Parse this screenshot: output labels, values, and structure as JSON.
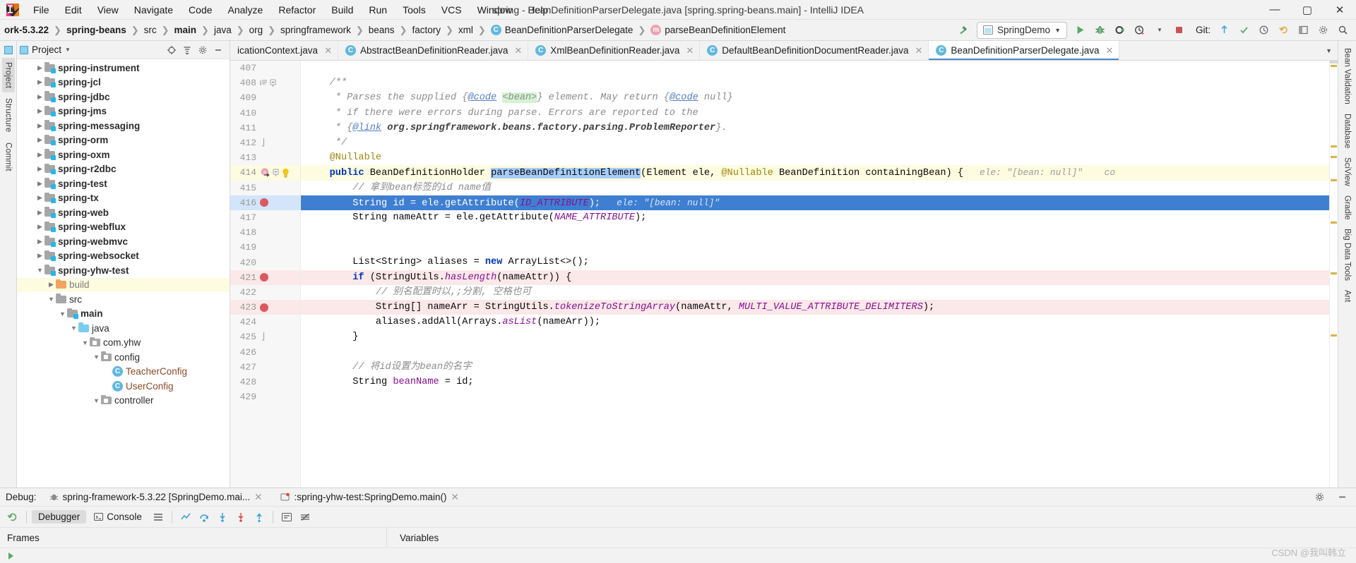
{
  "window": {
    "title": "spring - BeanDefinitionParserDelegate.java [spring.spring-beans.main] - IntelliJ IDEA",
    "minimize": "—",
    "maximize": "▢",
    "close": "✕"
  },
  "menu": {
    "items": [
      "File",
      "Edit",
      "View",
      "Navigate",
      "Code",
      "Analyze",
      "Refactor",
      "Build",
      "Run",
      "Tools",
      "VCS",
      "Window",
      "Help"
    ]
  },
  "breadcrumbs": {
    "items": [
      {
        "label": "ork-5.3.22",
        "bold": true,
        "icon": ""
      },
      {
        "label": "spring-beans",
        "bold": true,
        "icon": ""
      },
      {
        "label": "src",
        "bold": false,
        "icon": ""
      },
      {
        "label": "main",
        "bold": true,
        "icon": ""
      },
      {
        "label": "java",
        "bold": false,
        "icon": ""
      },
      {
        "label": "org",
        "bold": false,
        "icon": ""
      },
      {
        "label": "springframework",
        "bold": false,
        "icon": ""
      },
      {
        "label": "beans",
        "bold": false,
        "icon": ""
      },
      {
        "label": "factory",
        "bold": false,
        "icon": ""
      },
      {
        "label": "xml",
        "bold": false,
        "icon": ""
      },
      {
        "label": "BeanDefinitionParserDelegate",
        "bold": false,
        "icon": "class"
      },
      {
        "label": "parseBeanDefinitionElement",
        "bold": false,
        "icon": "method"
      }
    ],
    "separator": "❯"
  },
  "toolbar": {
    "build_icon": "hammer-icon",
    "run_config": "SpringDemo",
    "run_config_icon": "app-window-icon",
    "dropdown_arrow": "▼",
    "run_label": "▶",
    "debug_label": "debug-icon",
    "run_coverage_label": "coverage-icon",
    "profiler_label": "profiler-icon",
    "stop_label": "■",
    "git_label": "Git:",
    "git_update": "update-icon",
    "git_commit": "commit-icon",
    "git_history": "history-icon",
    "git_rollback": "rollback-icon",
    "search_label": "🔍",
    "settings_label": "gear-icon",
    "layout_label": "layout-icon"
  },
  "left_rail": {
    "items": [
      {
        "label": "Project",
        "selected": true
      },
      {
        "label": "Structure",
        "selected": false
      },
      {
        "label": "Commit",
        "selected": false
      }
    ]
  },
  "right_rail": {
    "items": [
      "Bean Validation",
      "Database",
      "SciView",
      "Gradle",
      "Big Data Tools",
      "Ant"
    ]
  },
  "project_panel": {
    "title": "Project",
    "dropdown": "▼",
    "actions": [
      "target-icon",
      "collapse-all-icon",
      "settings-icon",
      "hide-icon"
    ],
    "tree": [
      {
        "indent": 1,
        "arrow": "▶",
        "icon": "module-folder",
        "label": "spring-instrument",
        "bold": true,
        "highlight": false
      },
      {
        "indent": 1,
        "arrow": "▶",
        "icon": "module-folder",
        "label": "spring-jcl",
        "bold": true,
        "highlight": false
      },
      {
        "indent": 1,
        "arrow": "▶",
        "icon": "module-folder",
        "label": "spring-jdbc",
        "bold": true,
        "highlight": false
      },
      {
        "indent": 1,
        "arrow": "▶",
        "icon": "module-folder",
        "label": "spring-jms",
        "bold": true,
        "highlight": false
      },
      {
        "indent": 1,
        "arrow": "▶",
        "icon": "module-folder",
        "label": "spring-messaging",
        "bold": true,
        "highlight": false
      },
      {
        "indent": 1,
        "arrow": "▶",
        "icon": "module-folder",
        "label": "spring-orm",
        "bold": true,
        "highlight": false
      },
      {
        "indent": 1,
        "arrow": "▶",
        "icon": "module-folder",
        "label": "spring-oxm",
        "bold": true,
        "highlight": false
      },
      {
        "indent": 1,
        "arrow": "▶",
        "icon": "module-folder",
        "label": "spring-r2dbc",
        "bold": true,
        "highlight": false
      },
      {
        "indent": 1,
        "arrow": "▶",
        "icon": "module-folder",
        "label": "spring-test",
        "bold": true,
        "highlight": false
      },
      {
        "indent": 1,
        "arrow": "▶",
        "icon": "module-folder",
        "label": "spring-tx",
        "bold": true,
        "highlight": false
      },
      {
        "indent": 1,
        "arrow": "▶",
        "icon": "module-folder",
        "label": "spring-web",
        "bold": true,
        "highlight": false
      },
      {
        "indent": 1,
        "arrow": "▶",
        "icon": "module-folder",
        "label": "spring-webflux",
        "bold": true,
        "highlight": false
      },
      {
        "indent": 1,
        "arrow": "▶",
        "icon": "module-folder",
        "label": "spring-webmvc",
        "bold": true,
        "highlight": false
      },
      {
        "indent": 1,
        "arrow": "▶",
        "icon": "module-folder",
        "label": "spring-websocket",
        "bold": true,
        "highlight": false
      },
      {
        "indent": 1,
        "arrow": "▼",
        "icon": "module-folder",
        "label": "spring-yhw-test",
        "bold": true,
        "highlight": false
      },
      {
        "indent": 2,
        "arrow": "▶",
        "icon": "excluded-folder",
        "label": "build",
        "bold": false,
        "highlight": true,
        "grey": true
      },
      {
        "indent": 2,
        "arrow": "▼",
        "icon": "plain-folder",
        "label": "src",
        "bold": false,
        "highlight": false
      },
      {
        "indent": 3,
        "arrow": "▼",
        "icon": "module-folder",
        "label": "main",
        "bold": true,
        "highlight": false
      },
      {
        "indent": 4,
        "arrow": "▼",
        "icon": "source-folder",
        "label": "java",
        "bold": false,
        "highlight": false
      },
      {
        "indent": 5,
        "arrow": "▼",
        "icon": "package",
        "label": "com.yhw",
        "bold": false,
        "highlight": false
      },
      {
        "indent": 6,
        "arrow": "▼",
        "icon": "package",
        "label": "config",
        "bold": false,
        "highlight": false
      },
      {
        "indent": 7,
        "arrow": "",
        "icon": "class",
        "label": "TeacherConfig",
        "bold": false,
        "highlight": false,
        "cls": true
      },
      {
        "indent": 7,
        "arrow": "",
        "icon": "class",
        "label": "UserConfig",
        "bold": false,
        "highlight": false,
        "cls": true
      },
      {
        "indent": 6,
        "arrow": "▼",
        "icon": "package",
        "label": "controller",
        "bold": false,
        "highlight": false
      }
    ]
  },
  "editor_tabs": {
    "items": [
      {
        "label": "icationContext.java",
        "icon": "",
        "active": false,
        "close": "✕"
      },
      {
        "label": "AbstractBeanDefinitionReader.java",
        "icon": "class",
        "active": false,
        "close": "✕"
      },
      {
        "label": "XmlBeanDefinitionReader.java",
        "icon": "class",
        "active": false,
        "close": "✕"
      },
      {
        "label": "DefaultBeanDefinitionDocumentReader.java",
        "icon": "class",
        "active": false,
        "close": "✕"
      },
      {
        "label": "BeanDefinitionParserDelegate.java",
        "icon": "class",
        "active": true,
        "close": "✕"
      }
    ],
    "overflow": "▼",
    "settings_icon": "gear-icon",
    "hide_icon": "—"
  },
  "code": {
    "lines": [
      {
        "num": "407",
        "state": "normal",
        "segments": [],
        "icons": []
      },
      {
        "num": "408",
        "state": "hl_none",
        "icons": [
          "doc-marker",
          "fold-open"
        ],
        "segments": [
          {
            "t": "    ",
            "c": ""
          },
          {
            "t": "/**",
            "c": "jd"
          }
        ]
      },
      {
        "num": "409",
        "state": "normal",
        "icons": [],
        "segments": [
          {
            "t": "     * Parses the supplied {",
            "c": "jd"
          },
          {
            "t": "@code",
            "c": "jdlink"
          },
          {
            "t": " ",
            "c": "jd"
          },
          {
            "t": "<bean>",
            "c": "jd hlgreen"
          },
          {
            "t": "} element. May return {",
            "c": "jd"
          },
          {
            "t": "@code",
            "c": "jdlink"
          },
          {
            "t": " null}",
            "c": "jd"
          }
        ]
      },
      {
        "num": "410",
        "state": "normal",
        "icons": [],
        "segments": [
          {
            "t": "     * if there were errors during parse. Errors are reported to the",
            "c": "jd"
          }
        ]
      },
      {
        "num": "411",
        "state": "normal",
        "icons": [],
        "segments": [
          {
            "t": "     * {",
            "c": "jd"
          },
          {
            "t": "@link",
            "c": "jdlink"
          },
          {
            "t": " ",
            "c": "jd"
          },
          {
            "t": "org.springframework.beans.factory.parsing.ProblemReporter",
            "c": "jdtag"
          },
          {
            "t": "}.",
            "c": "jd"
          }
        ]
      },
      {
        "num": "412",
        "state": "normal",
        "icons": [
          "fold-close"
        ],
        "segments": [
          {
            "t": "     */",
            "c": "jd"
          }
        ]
      },
      {
        "num": "413",
        "state": "normal",
        "icons": [],
        "segments": [
          {
            "t": "    ",
            "c": ""
          },
          {
            "t": "@Nullable",
            "c": "ann"
          }
        ]
      },
      {
        "num": "414",
        "state": "hl",
        "icons": [
          "method-run",
          "fold-open",
          "bulb"
        ],
        "segments": [
          {
            "t": "    ",
            "c": ""
          },
          {
            "t": "public",
            "c": "kw"
          },
          {
            "t": " BeanDefinitionHolder ",
            "c": ""
          },
          {
            "t": "parseBeanDefinitionElement",
            "c": "sel"
          },
          {
            "t": "(Element ele, ",
            "c": ""
          },
          {
            "t": "@Nullable",
            "c": "ann"
          },
          {
            "t": " BeanDefinition containingBean) {",
            "c": ""
          },
          {
            "t": "   ele: \"[bean: null]\"    co",
            "c": "inlineval"
          }
        ]
      },
      {
        "num": "415",
        "state": "normal",
        "icons": [],
        "segments": [
          {
            "t": "        ",
            "c": ""
          },
          {
            "t": "// 拿到bean标签的id name值",
            "c": "cmt"
          }
        ]
      },
      {
        "num": "416",
        "state": "cur",
        "icons": [
          "bp"
        ],
        "segments": [
          {
            "t": "        String id = ele.getAttribute(",
            "c": ""
          },
          {
            "t": "ID_ATTRIBUTE",
            "c": "stat"
          },
          {
            "t": ");",
            "c": ""
          },
          {
            "t": "   ele: \"[bean: null]\"",
            "c": "inlineval"
          }
        ]
      },
      {
        "num": "417",
        "state": "normal",
        "icons": [],
        "segments": [
          {
            "t": "        String nameAttr = ele.getAttribute(",
            "c": ""
          },
          {
            "t": "NAME_ATTRIBUTE",
            "c": "stat"
          },
          {
            "t": ");",
            "c": ""
          }
        ]
      },
      {
        "num": "418",
        "state": "normal",
        "icons": [],
        "segments": []
      },
      {
        "num": "419",
        "state": "normal",
        "icons": [],
        "segments": []
      },
      {
        "num": "420",
        "state": "normal",
        "icons": [],
        "segments": [
          {
            "t": "        List<String> aliases = ",
            "c": ""
          },
          {
            "t": "new",
            "c": "kw"
          },
          {
            "t": " ArrayList<>();",
            "c": ""
          }
        ]
      },
      {
        "num": "421",
        "state": "bpline",
        "icons": [
          "bp"
        ],
        "segments": [
          {
            "t": "        ",
            "c": ""
          },
          {
            "t": "if",
            "c": "kw"
          },
          {
            "t": " (StringUtils.",
            "c": ""
          },
          {
            "t": "hasLength",
            "c": "stat"
          },
          {
            "t": "(nameAttr)) {",
            "c": ""
          }
        ]
      },
      {
        "num": "422",
        "state": "normal",
        "icons": [],
        "segments": [
          {
            "t": "            ",
            "c": ""
          },
          {
            "t": "// 别名配置时以,;分割, 空格也可",
            "c": "cmt"
          }
        ]
      },
      {
        "num": "423",
        "state": "bpline",
        "icons": [
          "bp"
        ],
        "segments": [
          {
            "t": "            String[] nameArr = StringUtils.",
            "c": ""
          },
          {
            "t": "tokenizeToStringArray",
            "c": "stat"
          },
          {
            "t": "(nameAttr, ",
            "c": ""
          },
          {
            "t": "MULTI_VALUE_ATTRIBUTE_DELIMITERS",
            "c": "stat"
          },
          {
            "t": ");",
            "c": ""
          }
        ]
      },
      {
        "num": "424",
        "state": "normal",
        "icons": [],
        "segments": [
          {
            "t": "            aliases.addAll(Arrays.",
            "c": ""
          },
          {
            "t": "asList",
            "c": "stat"
          },
          {
            "t": "(nameArr));",
            "c": ""
          }
        ]
      },
      {
        "num": "425",
        "state": "normal",
        "icons": [
          "fold-close"
        ],
        "segments": [
          {
            "t": "        }",
            "c": ""
          }
        ]
      },
      {
        "num": "426",
        "state": "normal",
        "icons": [],
        "segments": []
      },
      {
        "num": "427",
        "state": "normal",
        "icons": [],
        "segments": [
          {
            "t": "        ",
            "c": ""
          },
          {
            "t": "// 将id设置为bean的名字",
            "c": "cmt"
          }
        ]
      },
      {
        "num": "428",
        "state": "normal",
        "icons": [],
        "segments": [
          {
            "t": "        String ",
            "c": ""
          },
          {
            "t": "beanName",
            "c": "fld"
          },
          {
            "t": " = id;",
            "c": ""
          }
        ]
      },
      {
        "num": "429",
        "state": "normal",
        "icons": [],
        "segments": []
      }
    ]
  },
  "debug": {
    "label": "Debug:",
    "sessions": [
      {
        "label": "spring-framework-5.3.22 [SpringDemo.mai...",
        "close": "✕",
        "active": false
      },
      {
        "label": ":spring-yhw-test:SpringDemo.main()",
        "close": "✕",
        "active": true
      }
    ],
    "settings_icon": "gear-icon",
    "hide_icon": "—",
    "tabs": [
      {
        "label": "Debugger",
        "selected": true,
        "icon": ""
      },
      {
        "label": "Console",
        "selected": false,
        "icon": "console-icon"
      }
    ],
    "tool_icons": [
      "rerun-icon",
      "layout-icon",
      "chart-icon",
      "step-over-icon",
      "step-into-icon",
      "force-step-into-icon",
      "step-out-icon",
      "run-to-cursor-icon",
      "evaluate-icon",
      "mute-icon"
    ],
    "columns": {
      "frames": "Frames",
      "variables": "Variables"
    }
  },
  "watermark": "CSDN @我叫韩立"
}
